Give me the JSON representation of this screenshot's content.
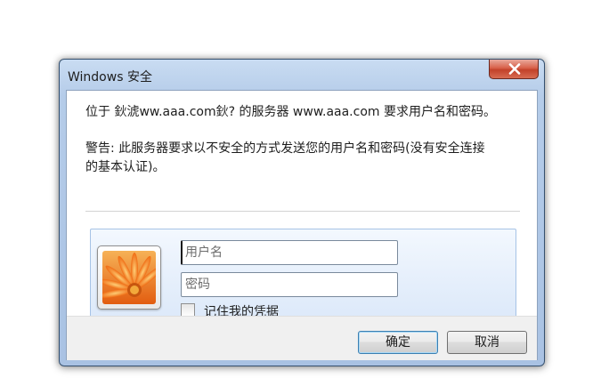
{
  "window": {
    "title": "Windows 安全",
    "close_icon": "close-icon"
  },
  "message": {
    "line1": "位于 鈥淲ww.aaa.com鈥? 的服务器 www.aaa.com 要求用户名和密码。",
    "warning_line1": "警告: 此服务器要求以不安全的方式发送您的用户名和密码(没有安全连接",
    "warning_line2": "的基本认证)。"
  },
  "credentials": {
    "avatar_icon": "user-tile-flower-icon",
    "username_placeholder": "用户名",
    "password_placeholder": "密码",
    "remember_label": "记住我的凭据",
    "remember_checked": false
  },
  "buttons": {
    "ok_label": "确定",
    "cancel_label": "取消"
  },
  "colors": {
    "title_bar": "#b5cce9",
    "close_button": "#d0523c",
    "panel_bg": "#e4eefb",
    "footer_bg": "#f0f0f0"
  }
}
